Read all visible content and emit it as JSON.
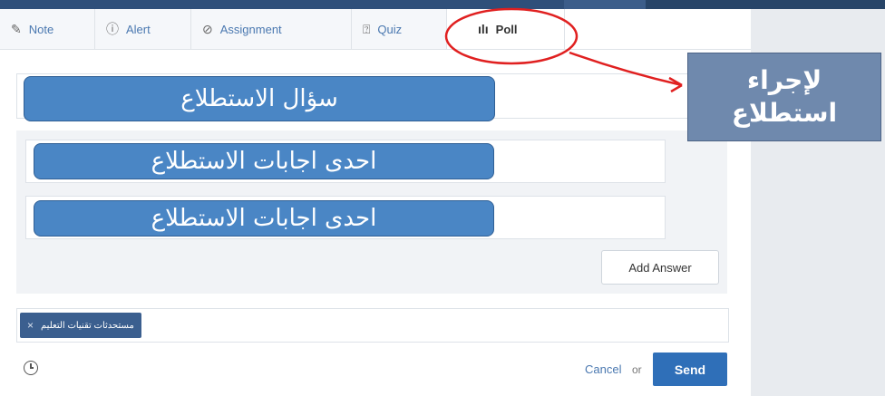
{
  "tabs": [
    {
      "label": "Note",
      "icon": "note-icon"
    },
    {
      "label": "Alert",
      "icon": "alert-icon"
    },
    {
      "label": "Assignment",
      "icon": "assignment-icon"
    },
    {
      "label": "Quiz",
      "icon": "quiz-icon"
    },
    {
      "label": "Poll",
      "icon": "poll-icon",
      "active": true
    }
  ],
  "poll": {
    "question_overlay": "سؤال الاستطلاع",
    "answers": [
      {
        "overlay": "احدى اجابات الاستطلاع"
      },
      {
        "overlay": "احدى اجابات الاستطلاع"
      }
    ],
    "add_answer_label": "Add Answer"
  },
  "recipients": {
    "chip_label": "مستحدثات تقنيات التعليم",
    "chip_remove": "×"
  },
  "footer": {
    "cancel_label": "Cancel",
    "or_label": "or",
    "send_label": "Send"
  },
  "annotation": {
    "line1": "لإجراء",
    "line2": "استطلاع"
  },
  "colors": {
    "accent": "#2f6fb8",
    "overlay": "#4a86c5",
    "annotation_circle": "#e02020",
    "callout": "#6f89ad"
  }
}
